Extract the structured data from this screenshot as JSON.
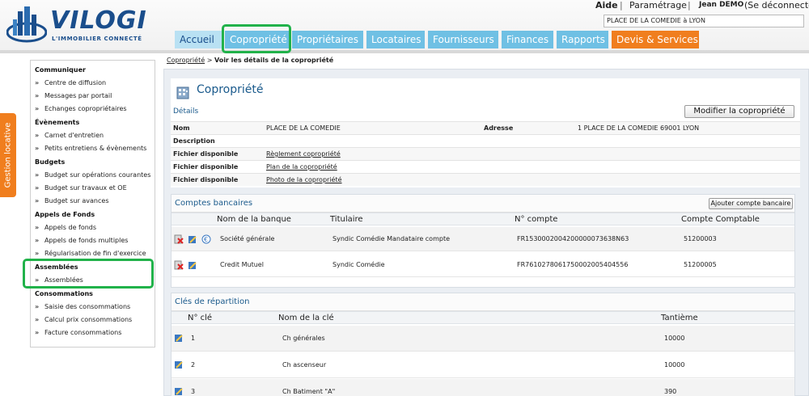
{
  "header": {
    "logo_text": "VILOGI",
    "logo_tagline": "L'IMMOBILIER CONNECTÉ",
    "links": {
      "help": "Aide",
      "separator": "|",
      "settings": "Paramétrage",
      "user": "Jean DEMO",
      "logout": "(Se déconnecter)"
    },
    "selected_property": "PLACE DE LA COMEDIE à LYON",
    "tabs": [
      {
        "label": "Accueil"
      },
      {
        "label": "Copropriété"
      },
      {
        "label": "Propriétaires"
      },
      {
        "label": "Locataires"
      },
      {
        "label": "Fournisseurs"
      },
      {
        "label": "Finances"
      },
      {
        "label": "Rapports"
      },
      {
        "label": "Devis & Services"
      }
    ],
    "colors": {
      "tab_blue": "#6fc0e4",
      "tab_home": "#b9e1f3",
      "tab_orange": "#f07e1e",
      "highlight_green": "#21b24a"
    }
  },
  "side_tab": {
    "label": "Gestion locative"
  },
  "left_menu": {
    "sections": [
      {
        "title": "Communiquer",
        "items": [
          "Centre de diffusion",
          "Messages par portail",
          "Echanges copropriétaires"
        ]
      },
      {
        "title": "Évènements",
        "items": [
          "Carnet d'entretien",
          "Petits entretiens & évènements"
        ]
      },
      {
        "title": "Budgets",
        "items": [
          "Budget sur opérations courantes",
          "Budget sur travaux et OE",
          "Budget sur avances"
        ]
      },
      {
        "title": "Appels de Fonds",
        "items": [
          "Appels de fonds",
          "Appels de fonds multiples",
          "Régularisation de fin d'exercice"
        ]
      },
      {
        "title": "Assemblées",
        "items": [
          "Assemblées"
        ]
      },
      {
        "title": "Consommations",
        "items": [
          "Saisie des consommations",
          "Calcul prix consommations",
          "Facture consommations"
        ]
      }
    ],
    "chevron": "»"
  },
  "breadcrumb": {
    "parent": "Copropriété",
    "separator": ">",
    "current": "Voir les détails de la copropriété"
  },
  "page": {
    "title": "Copropriété",
    "details": {
      "section_title": "Détails",
      "edit_button": "Modifier la copropriété",
      "rows": [
        {
          "label": "Nom",
          "value": "PLACE DE LA COMEDIE",
          "label2": "Adresse",
          "value2": "1 PLACE DE LA COMEDIE 69001 LYON"
        },
        {
          "label": "Description",
          "value": ""
        },
        {
          "label": "Fichier disponible",
          "value": "Règlement copropriété"
        },
        {
          "label": "Fichier disponible",
          "value": "Plan de la copropriété"
        },
        {
          "label": "Fichier disponible",
          "value": "Photo de la copropriété"
        }
      ]
    },
    "bank_accounts": {
      "section_title": "Comptes bancaires",
      "add_button": "Ajouter compte bancaire",
      "columns": [
        "Nom de la banque",
        "Titulaire",
        "N° compte",
        "Compte Comptable"
      ],
      "rows": [
        {
          "bank": "Société générale",
          "holder": "Syndic Comédie Mandataire compte",
          "account": "FR1530002004200000073638N63",
          "ledger": "51200003"
        },
        {
          "bank": "Credit Mutuel",
          "holder": "Syndic Comédie",
          "account": "FR7610278061750002005404556",
          "ledger": "51200005"
        }
      ]
    },
    "allocation_keys": {
      "section_title": "Clés de répartition",
      "columns": [
        "N° clé",
        "Nom de la clé",
        "Tantième"
      ],
      "rows": [
        {
          "num": "1",
          "name": "Ch générales",
          "share": "10000"
        },
        {
          "num": "2",
          "name": "Ch ascenseur",
          "share": "10000"
        },
        {
          "num": "3",
          "name": "Ch Batiment \"A\"",
          "share": "390"
        }
      ]
    }
  }
}
